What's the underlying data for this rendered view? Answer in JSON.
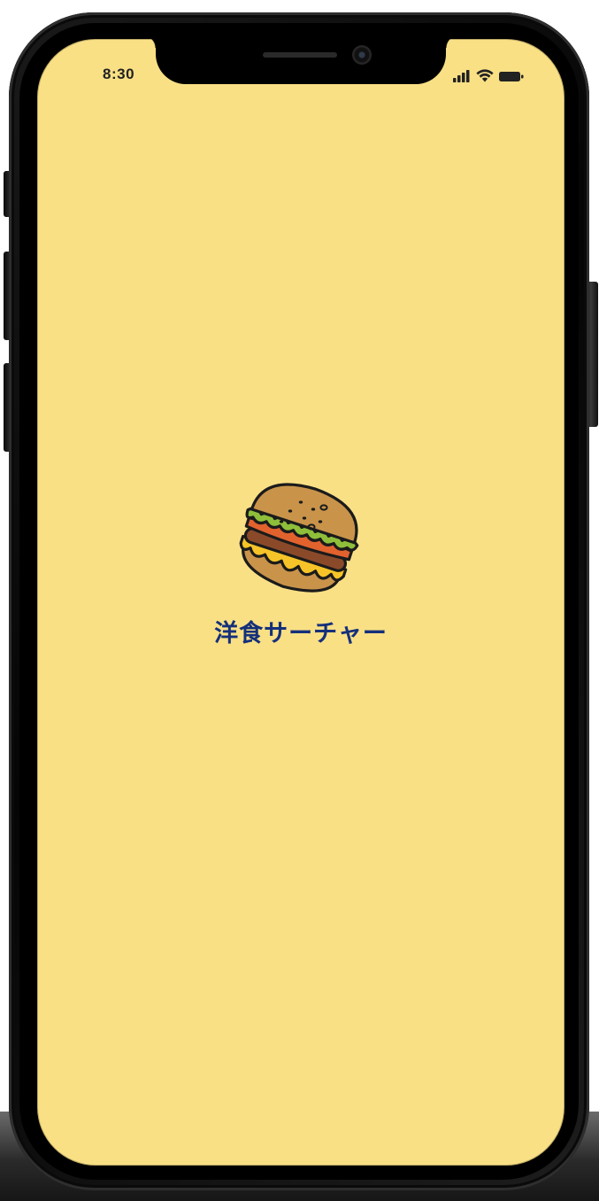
{
  "status_bar": {
    "time": "8:30",
    "icons": [
      "cellular-signal-icon",
      "wifi-icon",
      "battery-icon"
    ]
  },
  "splash": {
    "app_name": "洋食サーチャー",
    "logo_icon": "hamburger-icon"
  },
  "colors": {
    "screen_background": "#fae085",
    "title_text": "#15307a",
    "bun": "#c9944a",
    "lettuce": "#8fbf3a",
    "tomato": "#e2622e",
    "cheese": "#f6c428",
    "patty": "#8a4a2a"
  }
}
